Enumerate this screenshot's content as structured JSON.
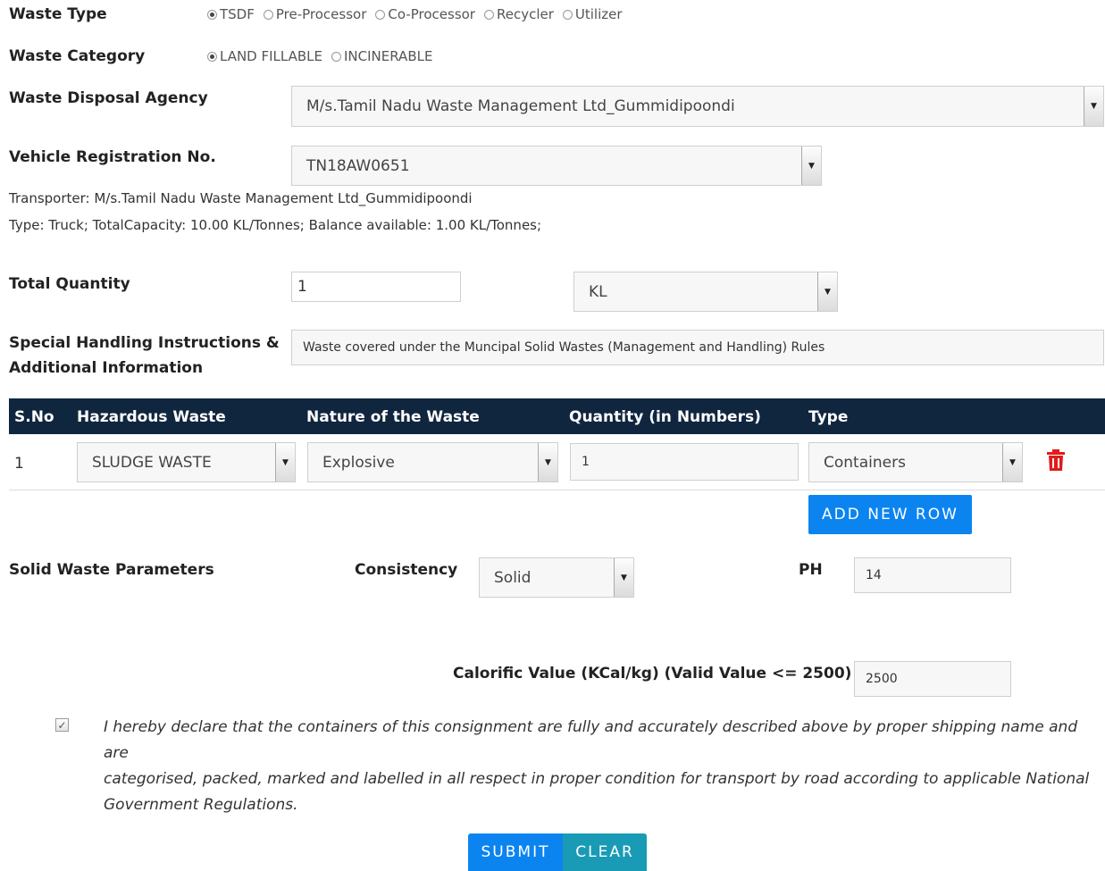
{
  "waste_type": {
    "label": "Waste Type",
    "options": [
      "TSDF",
      "Pre-Processor",
      "Co-Processor",
      "Recycler",
      "Utilizer"
    ]
  },
  "waste_category": {
    "label": "Waste Category",
    "options": [
      "LAND FILLABLE",
      "INCINERABLE"
    ]
  },
  "disposal_agency": {
    "label": "Waste Disposal Agency",
    "value": "M/s.Tamil Nadu Waste Management Ltd_Gummidipoondi"
  },
  "vehicle": {
    "label": "Vehicle Registration No.",
    "value": "TN18AW0651",
    "transporter_line": "Transporter: M/s.Tamil Nadu Waste Management Ltd_Gummidipoondi",
    "info_line": "Type: Truck; TotalCapacity: 10.00 KL/Tonnes; Balance available: 1.00 KL/Tonnes;"
  },
  "total_quantity": {
    "label": "Total Quantity",
    "value": "1",
    "unit": "KL"
  },
  "special_handling": {
    "label_line1": "Special Handling Instructions &",
    "label_line2": "Additional Information",
    "value": "Waste covered under the Muncipal Solid Wastes (Management and Handling) Rules"
  },
  "waste_table": {
    "headers": [
      "S.No",
      "Hazardous Waste",
      "Nature of the Waste",
      "Quantity (in Numbers)",
      "Type"
    ],
    "rows": [
      {
        "sno": "1",
        "hazardous_waste": "SLUDGE WASTE",
        "nature": "Explosive",
        "quantity": "1",
        "type": "Containers"
      }
    ],
    "add_row_label": "ADD NEW ROW"
  },
  "solid_params": {
    "label": "Solid Waste Parameters",
    "consistency_label": "Consistency",
    "consistency_value": "Solid",
    "ph_label": "PH",
    "ph_value": "14",
    "calorific_label": "Calorific Value (KCal/kg) (Valid Value <= 2500)",
    "calorific_value": "2500"
  },
  "declaration": {
    "checked": true,
    "line1": "I hereby declare that the containers of this consignment are fully and accurately described above by proper shipping name and are",
    "line2": "categorised, packed, marked and labelled in all respect in proper condition for transport by road according to applicable National",
    "line3": "Government Regulations."
  },
  "actions": {
    "submit_label": "SUBMIT",
    "clear_label": "CLEAR"
  },
  "colors": {
    "table_header": "#10263f",
    "primary_button": "#0b84f0",
    "clear_button": "#1a9bb5",
    "delete_icon": "#e11b1b"
  }
}
